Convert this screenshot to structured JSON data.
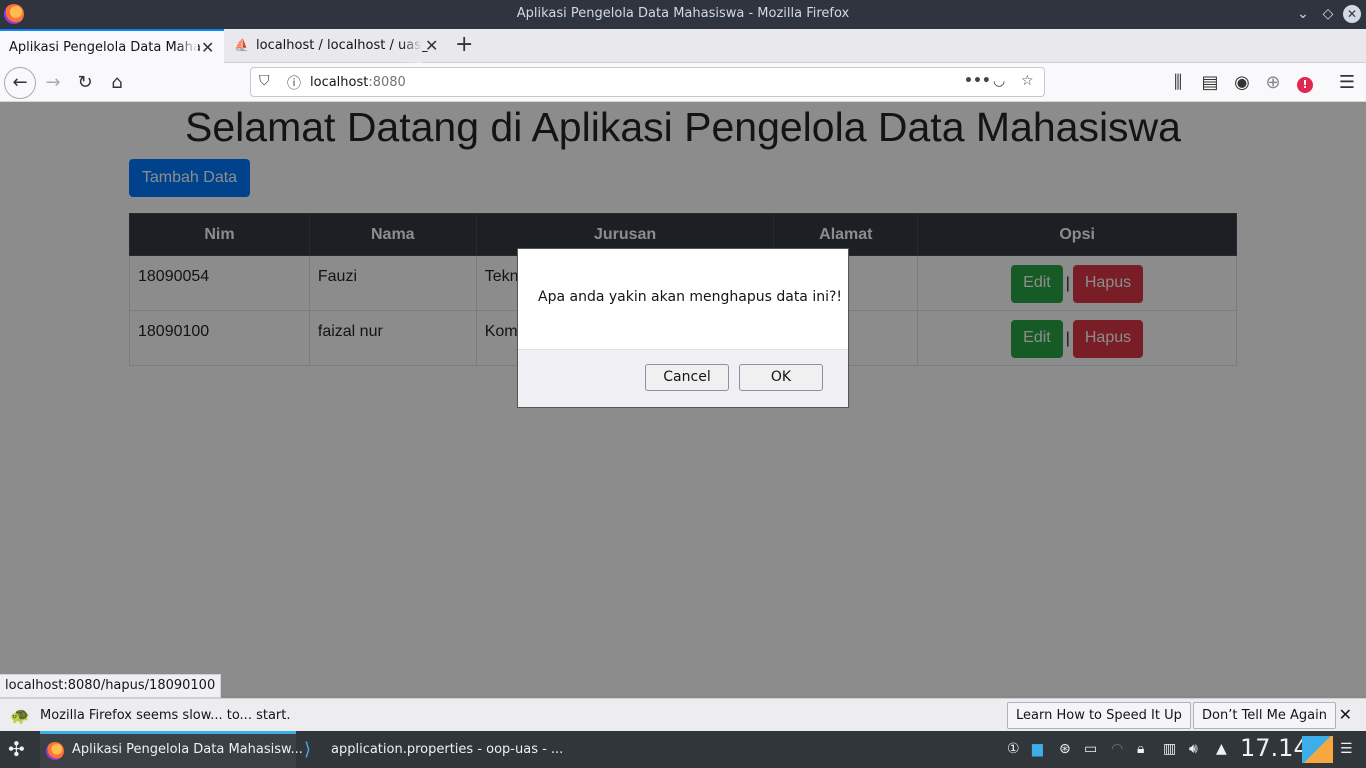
{
  "window": {
    "title": "Aplikasi Pengelola Data Mahasiswa - Mozilla Firefox"
  },
  "tabs": [
    {
      "label": "Aplikasi Pengelola Data Maha"
    },
    {
      "label": "localhost / localhost / uas_"
    }
  ],
  "url": {
    "host": "localhost",
    "port": ":8080"
  },
  "page": {
    "title": "Selamat Datang di Aplikasi Pengelola Data Mahasiswa",
    "add_label": "Tambah Data",
    "columns": [
      "Nim",
      "Nama",
      "Jurusan",
      "Alamat",
      "Opsi"
    ],
    "rows": [
      {
        "nim": "18090054",
        "nama": "Fauzi",
        "jurusan": "Tekn"
      },
      {
        "nim": "18090100",
        "nama": "faizal nur",
        "jurusan": "Kom"
      }
    ],
    "edit_label": "Edit",
    "hapus_label": "Hapus",
    "separator": "|"
  },
  "dialog": {
    "message": "Apa anda yakin akan menghapus data ini?!",
    "cancel_label": "Cancel",
    "ok_label": "OK"
  },
  "status_url": "localhost:8080/hapus/18090100",
  "notification": {
    "message": "Mozilla Firefox seems slow... to... start.",
    "learn_label": "Learn How to Speed It Up",
    "dont_label": "Don’t Tell Me Again"
  },
  "taskbar": {
    "tasks": [
      {
        "label": "Aplikasi Pengelola Data Mahasisw..."
      },
      {
        "label": "application.properties - oop-uas - ..."
      }
    ],
    "clock": "17.14"
  }
}
